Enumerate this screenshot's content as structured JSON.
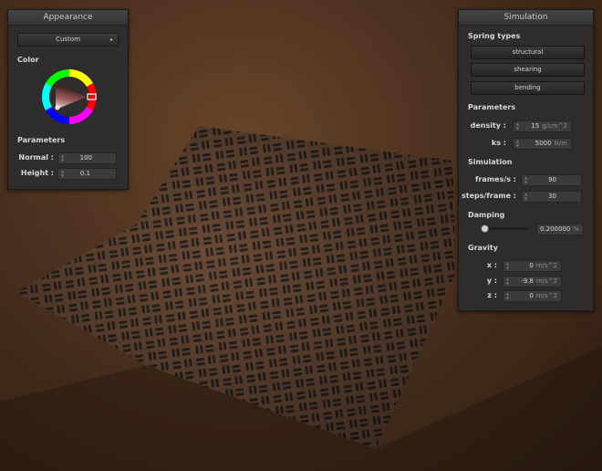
{
  "appearance": {
    "title": "Appearance",
    "preset": "Custom",
    "color_label": "Color",
    "parameters_label": "Parameters",
    "normal_label": "Normal :",
    "normal_value": "100",
    "height_label": "Height :",
    "height_value": "0.1",
    "selected_color": "#c31f1f"
  },
  "simulation": {
    "title": "Simulation",
    "spring_types_label": "Spring types",
    "springs": [
      "structural",
      "shearing",
      "bending"
    ],
    "parameters_label": "Parameters",
    "density_label": "density :",
    "density_value": "15",
    "density_unit": "g/cm^2",
    "ks_label": "ks :",
    "ks_value": "5000",
    "ks_unit": "N/m",
    "simulation_label": "Simulation",
    "fps_label": "frames/s :",
    "fps_value": "90",
    "steps_label": "steps/frame :",
    "steps_value": "30",
    "damping_label": "Damping",
    "damping_value": "0.200000",
    "damping_unit": "%",
    "damping_fraction": 0.002,
    "gravity_label": "Gravity",
    "gx_label": "x :",
    "gx_value": "0",
    "gy_label": "y :",
    "gy_value": "-9.8",
    "gz_label": "z :",
    "gz_value": "0",
    "g_unit": "m/s^2"
  }
}
